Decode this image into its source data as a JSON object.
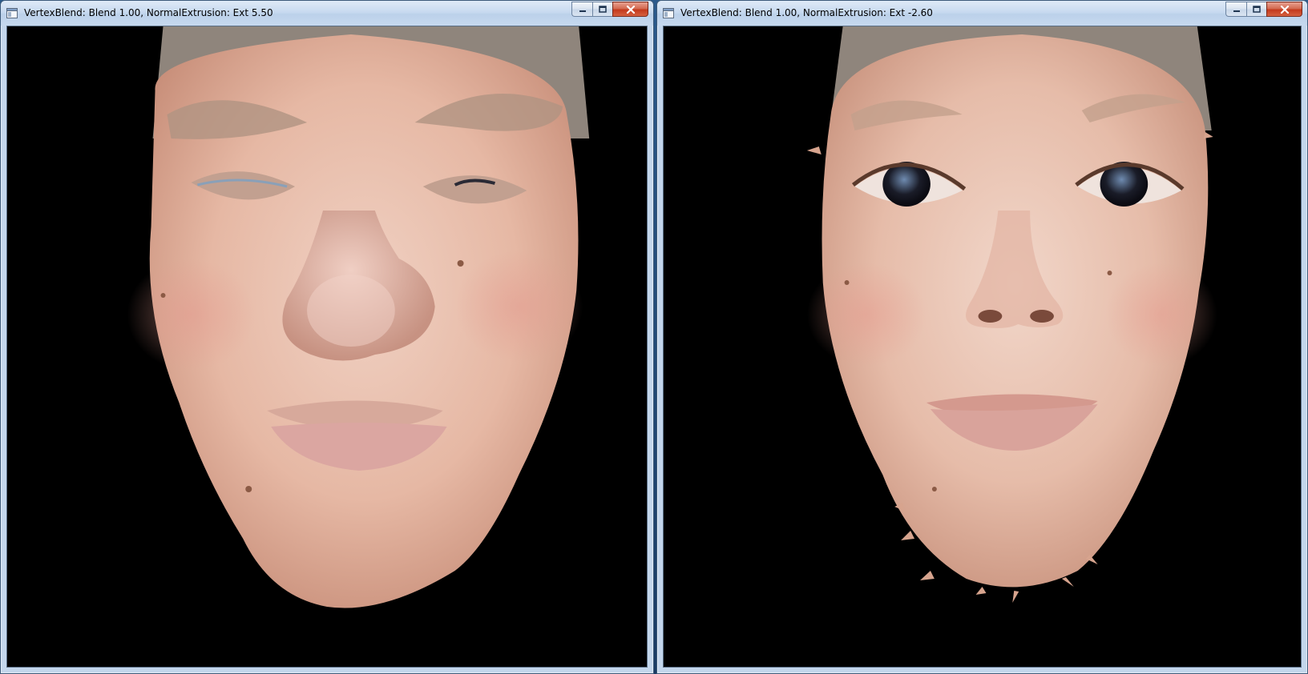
{
  "windows": [
    {
      "title": "VertexBlend: Blend 1.00, NormalExtrusion: Ext 5.50",
      "icon": "app-window-icon",
      "buttons": [
        "minimize-icon",
        "maximize-icon",
        "close-icon"
      ]
    },
    {
      "title": "VertexBlend: Blend 1.00, NormalExtrusion: Ext -2.60",
      "icon": "app-window-icon",
      "buttons": [
        "minimize-icon",
        "maximize-icon",
        "close-icon"
      ]
    }
  ],
  "colors": {
    "viewport_background": "#000000",
    "skin": "#e8b9a6",
    "cap": "#8a7f76",
    "close_button": "#c4391c"
  }
}
